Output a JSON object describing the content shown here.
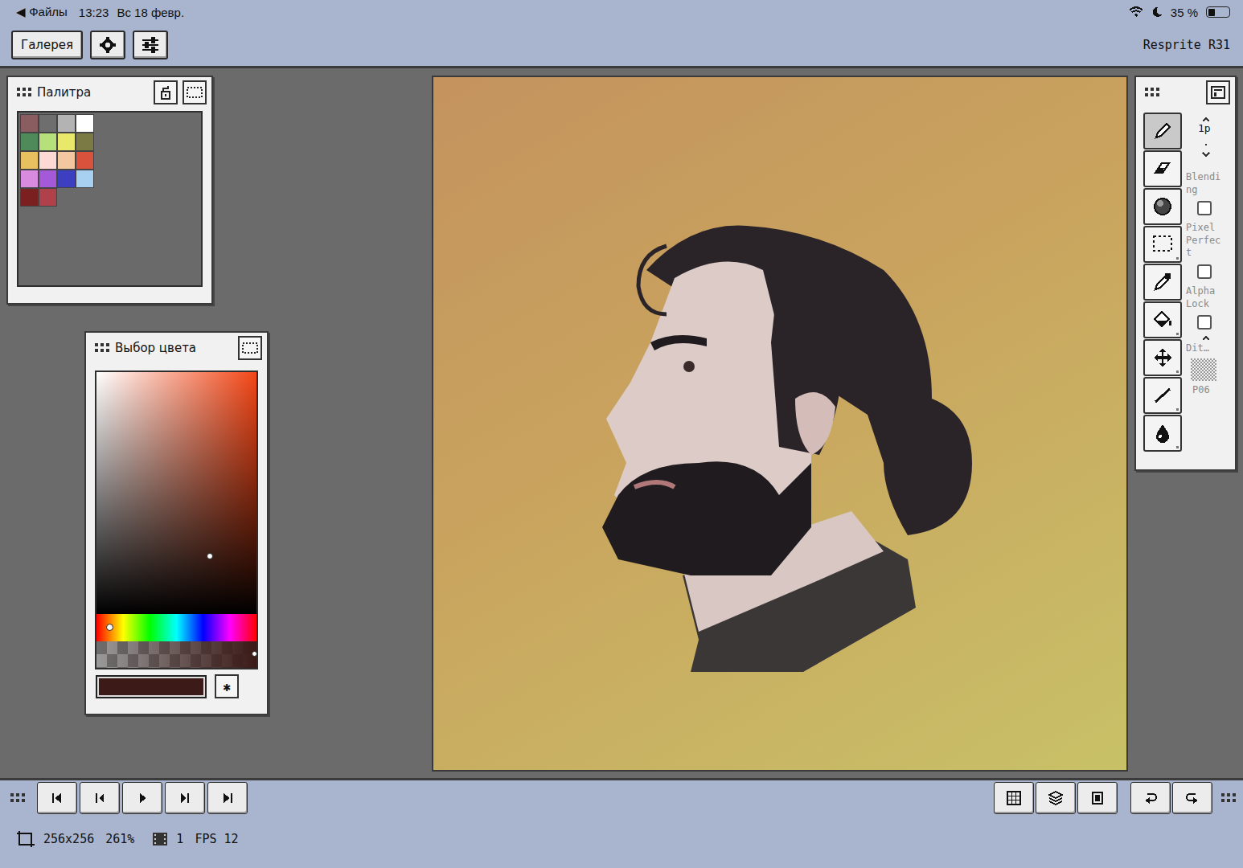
{
  "status_bar": {
    "back": "◀ Файлы",
    "time": "13:23",
    "date": "Вс 18 февр.",
    "battery": "35 %",
    "battery_level": 0.35
  },
  "toolbar": {
    "gallery": "Галерея",
    "app": "Resprite R31"
  },
  "palette": {
    "title": "Палитра",
    "colors": [
      {
        "color": "#8a5e60"
      },
      {
        "color": "#6e6e6e"
      },
      {
        "color": "#b3b3b3"
      },
      {
        "color": "#ffffff"
      },
      {
        "color": "#4e8a5a"
      },
      {
        "color": "#b5e07a"
      },
      {
        "color": "#e8e86a"
      },
      {
        "color": "#7b7a45"
      },
      {
        "color": "#e8c060"
      },
      {
        "color": "#fcd9d4"
      },
      {
        "color": "#f3c7a0"
      },
      {
        "color": "#d9533c"
      },
      {
        "color": "#d98be0"
      },
      {
        "color": "#a45ad8"
      },
      {
        "color": "#3c40c0"
      },
      {
        "color": "#a8d0f0"
      },
      {
        "color": "#7a2020"
      },
      {
        "color": "#b0404a"
      }
    ]
  },
  "color_picker": {
    "title": "Выбор цвета",
    "hue_level": 0.035,
    "saturation": 0.71,
    "value": 0.24,
    "alpha_level": 1,
    "current": {
      "color": "#3b1a17"
    },
    "hex_button": "✱"
  },
  "tools": {
    "items": [
      {
        "kind": "pencil",
        "selected": true
      },
      {
        "kind": "eraser",
        "selected": false
      },
      {
        "kind": "shade",
        "selected": false
      },
      {
        "kind": "select",
        "selected": false
      },
      {
        "kind": "eyedropper",
        "selected": false
      },
      {
        "kind": "fill",
        "selected": false
      },
      {
        "kind": "move",
        "selected": false
      },
      {
        "kind": "line",
        "selected": false
      },
      {
        "kind": "smudge",
        "selected": false
      }
    ],
    "size": "1p",
    "options": [
      {
        "label": "Blending",
        "checked": false
      },
      {
        "label": "Pixel Perfect",
        "checked": false
      },
      {
        "label": "Alpha Lock",
        "checked": false
      }
    ],
    "dither": {
      "label": "Dit…",
      "pattern": "P06"
    }
  },
  "status": {
    "size": "256x256",
    "zoom": "261%",
    "frame": "1",
    "fps": "FPS 12"
  }
}
